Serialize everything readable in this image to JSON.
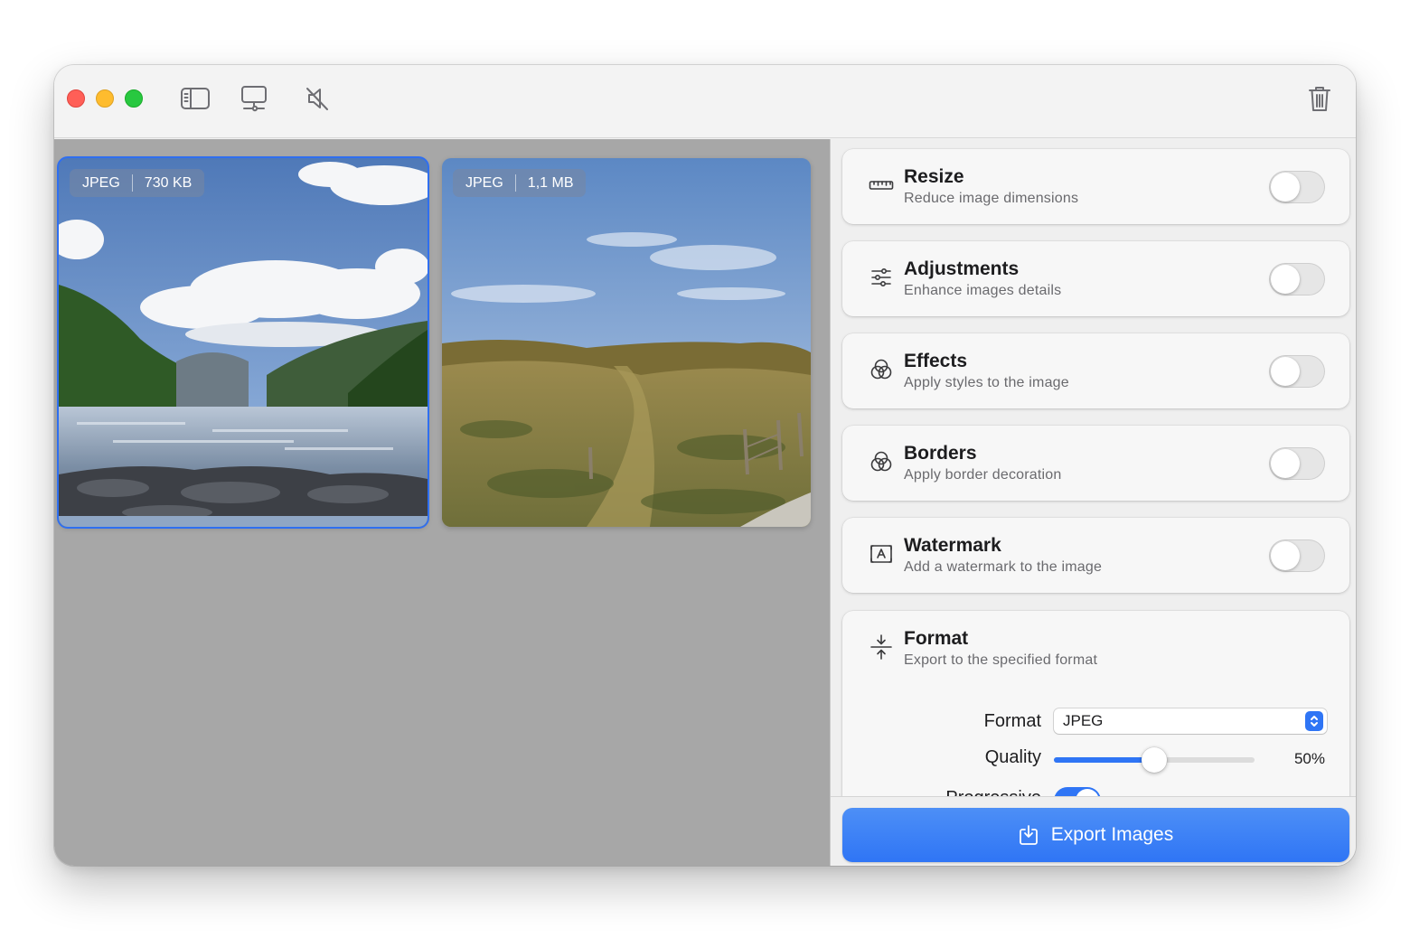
{
  "window": {
    "toolbar": {
      "icons": [
        "sidebar-icon",
        "display-icon",
        "muted-speaker-icon",
        "trash-icon"
      ]
    }
  },
  "images": [
    {
      "format": "JPEG",
      "size": "730 KB",
      "selected": true
    },
    {
      "format": "JPEG",
      "size": "1,1 MB",
      "selected": false
    }
  ],
  "panel": {
    "cards": [
      {
        "title": "Resize",
        "subtitle": "Reduce image dimensions",
        "icon": "ruler-icon",
        "enabled": false
      },
      {
        "title": "Adjustments",
        "subtitle": "Enhance images details",
        "icon": "sliders-icon",
        "enabled": false
      },
      {
        "title": "Effects",
        "subtitle": "Apply styles to the image",
        "icon": "circles-icon",
        "enabled": false
      },
      {
        "title": "Borders",
        "subtitle": "Apply border decoration",
        "icon": "circles-icon",
        "enabled": false
      },
      {
        "title": "Watermark",
        "subtitle": "Add a watermark to the image",
        "icon": "watermark-icon",
        "enabled": false
      }
    ],
    "format": {
      "title": "Format",
      "subtitle": "Export to the specified format",
      "icon": "compress-icon",
      "format_label": "Format",
      "format_value": "JPEG",
      "quality_label": "Quality",
      "quality_percent": 50,
      "quality_value": "50%",
      "progressive_label": "Progressive",
      "progressive_enabled": true
    },
    "export_button": "Export Images"
  },
  "colors": {
    "accent": "#2f75f5",
    "selection": "#2f6ff0",
    "canvas_bg": "#a7a7a7",
    "panel_bg": "#efefef"
  }
}
